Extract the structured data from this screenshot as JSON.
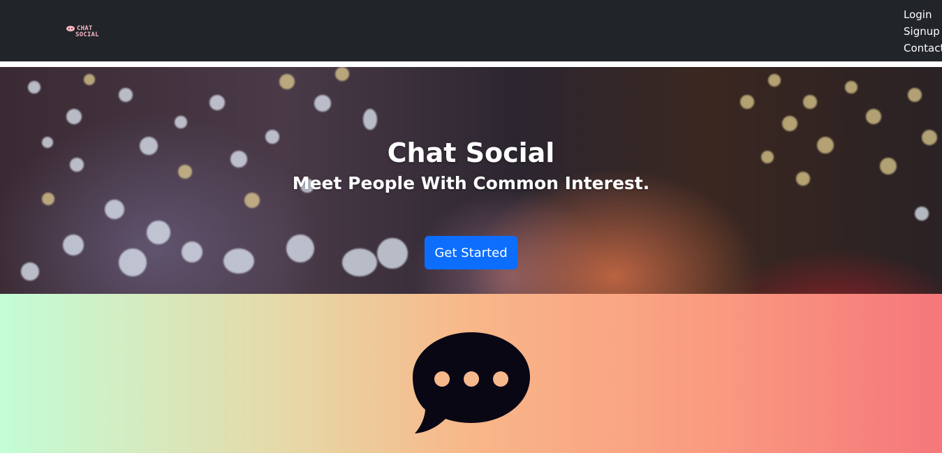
{
  "navbar": {
    "logo": {
      "line1": "CHAT",
      "line2": "SOCIAL"
    },
    "links": [
      "Login",
      "Signup",
      "Contact"
    ]
  },
  "hero": {
    "title": "Chat Social",
    "subtitle": "Meet People With Common Interest.",
    "cta_label": "Get Started"
  },
  "feature": {
    "icon": "chat-bubble-icon"
  },
  "colors": {
    "navbar_bg": "#212529",
    "cta_bg": "#0d6efd",
    "gradient_start": "#c3fdd6",
    "gradient_mid": "#f8b789",
    "gradient_end": "#f5777b",
    "icon_fill": "#0a0715",
    "icon_dots": "#f6b98c"
  }
}
